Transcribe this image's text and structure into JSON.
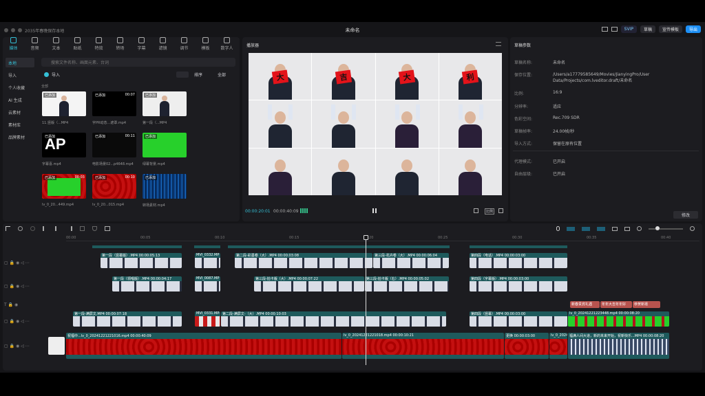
{
  "title": "未命名",
  "window_left": "2035年春晚保存本地",
  "top_right": {
    "vip": "SVIP",
    "b1": "草稿",
    "b2": "宣传模板",
    "export": "导出"
  },
  "tabs": [
    "媒体",
    "音频",
    "文本",
    "贴纸",
    "特效",
    "转场",
    "字幕",
    "滤镜",
    "调节",
    "模板",
    "数字人"
  ],
  "side": [
    "本地",
    "导入",
    "个人收藏",
    "AI 生成",
    "云素材",
    "素材库",
    "品牌素材"
  ],
  "search_placeholder": "搜索文件名称、画面元素、台词",
  "import_label": "导入",
  "sort_label": "排序",
  "all_label": "全部",
  "group_label": "全部",
  "media": [
    {
      "badge": "已添加",
      "dur": "",
      "name": "11.竖版（...MP4"
    },
    {
      "badge": "已添加",
      "dur": "00:07",
      "name": "字PR动态...遮罩.mp4"
    },
    {
      "badge": "已添加",
      "dur": "",
      "name": "第一段（...MP4"
    },
    {
      "badge": "已添加",
      "dur": "00:14",
      "name": "字幕喜.mp4"
    },
    {
      "badge": "已添加",
      "dur": "00:11",
      "name": "电影场景02...p4648.mp4"
    },
    {
      "badge": "已添加",
      "dur": "",
      "name": "绿幕背景.mp4"
    },
    {
      "badge": "已添加",
      "dur": "00:03",
      "name": "lv_0_20...449.mp4"
    },
    {
      "badge": "已添加",
      "dur": "00:10",
      "name": "lv_0_20...015.mp4"
    },
    {
      "badge": "已添加",
      "dur": "",
      "name": "转场素材.mp4"
    }
  ],
  "player": {
    "title": "播放器",
    "current": "00:00:20:01",
    "total": "00:00:40:09",
    "ratio": "比例",
    "cards": [
      "大",
      "吉",
      "大",
      "利"
    ]
  },
  "draft": {
    "title": "草稿参数",
    "rows": [
      {
        "k": "草稿名称:",
        "v": "未命名"
      },
      {
        "k": "保存位置:",
        "v": "/Users/a17779585649/Movies/JianyingPro/User Data/Projects/com.lveditor.draft/未命名"
      },
      {
        "k": "比例:",
        "v": "16:9"
      },
      {
        "k": "分辨率:",
        "v": "适应"
      },
      {
        "k": "色彩空间:",
        "v": "Rec.709 SDR"
      },
      {
        "k": "草稿帧率:",
        "v": "24.00帧/秒"
      },
      {
        "k": "导入方式:",
        "v": "保留在原有位置"
      },
      {
        "k": "代理模式:",
        "v": "已开启"
      },
      {
        "k": "自由层级:",
        "v": "已开启"
      }
    ],
    "edit": "修改"
  },
  "tracks": [
    {
      "clips": [
        {
          "l": "第一段（竖幕版）.MP4  00:00:05:13"
        },
        {
          "l": "MVI_0332.MP"
        },
        {
          "l": "第二段-彩墨卷（大）.MP4  00:00:03:08"
        },
        {
          "l": "第三段-花卉卷（大）.MP4  00:00:06:04"
        },
        {
          "l": "第四段（电话）.MP4  00:00:03:00"
        }
      ]
    },
    {
      "clips": [
        {
          "l": "第一段（领唱版）.MP4  00:00:04:17"
        },
        {
          "l": "MVI_0087.MP"
        },
        {
          "l": "第三段-拍卡版（大）.MP4  00:00:07:22"
        },
        {
          "l": "第三段-拍卡版（右）.MP4  00:00:05:02"
        },
        {
          "l": "第四段（字幕版）.MP4  00:00:03:00"
        }
      ]
    },
    {
      "clips": [
        {
          "l": "新春贵宾礼遇"
        },
        {
          "l": "年年大吉年年好"
        },
        {
          "l": "恭贺新禧"
        }
      ]
    },
    {
      "clips": [
        {
          "l": "第一段-满屏文.MP4  00:00:07:18"
        },
        {
          "l": "MVI_0331.MP4"
        },
        {
          "l": "第二段-满屏文-（大）.MP4  00:00:10:03"
        },
        {
          "l": "第四段（竖幕）.MP4  00:00:03:00"
        },
        {
          "l": "lv_0_20241221223448.mp4  00:00:08:20"
        }
      ]
    },
    {
      "clips": [
        {
          "l": "祝福中...lv_0_20241221221016.mp4  00:00:40:09"
        },
        {
          "l": "lv_0_20241221221018.mp4  00:00:10:21"
        },
        {
          "l": "更换  00:00:03:00"
        },
        {
          "l": "lv_0_2024..."
        },
        {
          "l": "福满人间大道，新的未来开始，祝新快乐...MP4  00:00:08:20"
        }
      ]
    }
  ],
  "ruler": [
    "00:00",
    "00:05",
    "00:10",
    "00:15",
    "00:20",
    "00:25",
    "00:30",
    "00:35",
    "00:40"
  ]
}
